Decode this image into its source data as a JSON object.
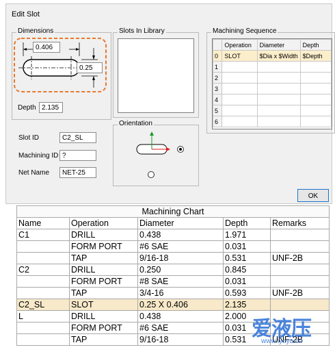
{
  "dialog": {
    "title": "Edit Slot",
    "dimensions": {
      "group_title": "Dimensions",
      "width_value": "0.406",
      "height_value": "0.25",
      "depth_label": "Depth",
      "depth_value": "2.135"
    },
    "slots_library": {
      "group_title": "Slots In Library"
    },
    "fields": {
      "slot_id_label": "Slot ID",
      "slot_id_value": "C2_SL",
      "machining_id_label": "Machining ID",
      "machining_id_value": "?",
      "net_name_label": "Net Name",
      "net_name_value": "NET-25"
    },
    "orientation": {
      "group_title": "Orientation"
    },
    "sequence": {
      "group_title": "Machining Sequence",
      "headers": [
        "Operation",
        "Diameter",
        "Depth"
      ],
      "rows": [
        {
          "num": "0",
          "operation": "SLOT",
          "diameter": "$Dia x $Width",
          "depth": "$Depth"
        },
        {
          "num": "1",
          "operation": "",
          "diameter": "",
          "depth": ""
        },
        {
          "num": "2",
          "operation": "",
          "diameter": "",
          "depth": ""
        },
        {
          "num": "3",
          "operation": "",
          "diameter": "",
          "depth": ""
        },
        {
          "num": "4",
          "operation": "",
          "diameter": "",
          "depth": ""
        },
        {
          "num": "5",
          "operation": "",
          "diameter": "",
          "depth": ""
        },
        {
          "num": "6",
          "operation": "",
          "diameter": "",
          "depth": ""
        }
      ]
    },
    "ok_label": "OK"
  },
  "machining_chart": {
    "title": "Machining Chart",
    "headers": [
      "Name",
      "Operation",
      "Diameter",
      "Depth",
      "Remarks"
    ],
    "rows": [
      [
        "C1",
        "DRILL",
        "0.438",
        "1.971",
        ""
      ],
      [
        "",
        "FORM PORT",
        "#6 SAE",
        "0.031",
        ""
      ],
      [
        "",
        "TAP",
        "9/16-18",
        "0.531",
        "UNF-2B"
      ],
      [
        "C2",
        "DRILL",
        "0.250",
        "0.845",
        ""
      ],
      [
        "",
        "FORM PORT",
        "#8 SAE",
        "0.031",
        ""
      ],
      [
        "",
        "TAP",
        "3/4-16",
        "0.593",
        "UNF-2B"
      ],
      [
        "C2_SL",
        "SLOT",
        "0.25 X 0.406",
        "2.135",
        ""
      ],
      [
        "L",
        "DRILL",
        "0.438",
        "2.000",
        ""
      ],
      [
        "",
        "FORM PORT",
        "#6 SAE",
        "0.031",
        ""
      ],
      [
        "",
        "TAP",
        "9/16-18",
        "0.531",
        "UNF-2B"
      ]
    ],
    "highlight_row": 6
  },
  "watermark": {
    "brand": "爱液压",
    "url": "www.iyeya.cn"
  },
  "colors": {
    "dashed_highlight": "#e8782a",
    "row_highlight": "#f7e9c9",
    "ok_border": "#1a73c9"
  }
}
